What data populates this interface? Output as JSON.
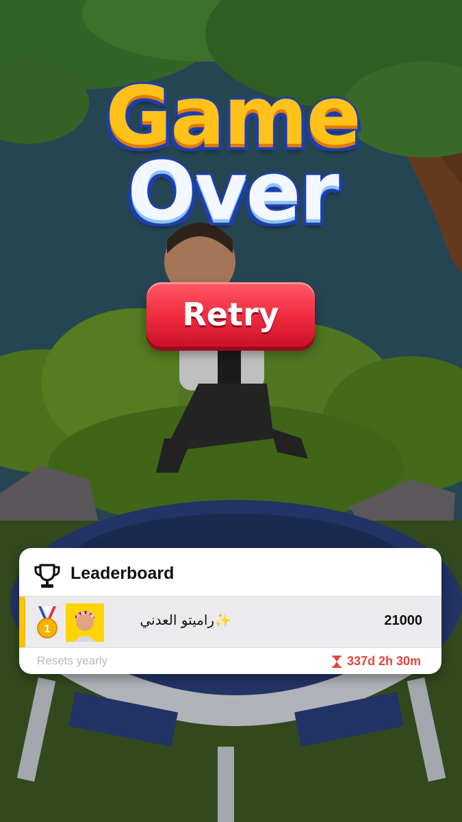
{
  "game": {
    "title_line1": "Game",
    "title_line2": "Over",
    "retry_label": "Retry"
  },
  "leaderboard": {
    "title": "Leaderboard",
    "entries": [
      {
        "rank": "1",
        "name": "راميتو العدني✨",
        "score": "21000"
      }
    ],
    "reset_note": "Resets yearly",
    "countdown": "337d 2h 30m"
  },
  "colors": {
    "retry_button": "#f02a3d",
    "title_yellow": "#ffc21a",
    "title_outline": "#1d3fae",
    "rank_accent": "#ffc300",
    "timer_red": "#e0463d"
  },
  "icons": [
    "trophy-icon",
    "medal-icon",
    "hourglass-icon",
    "player-avatar"
  ]
}
